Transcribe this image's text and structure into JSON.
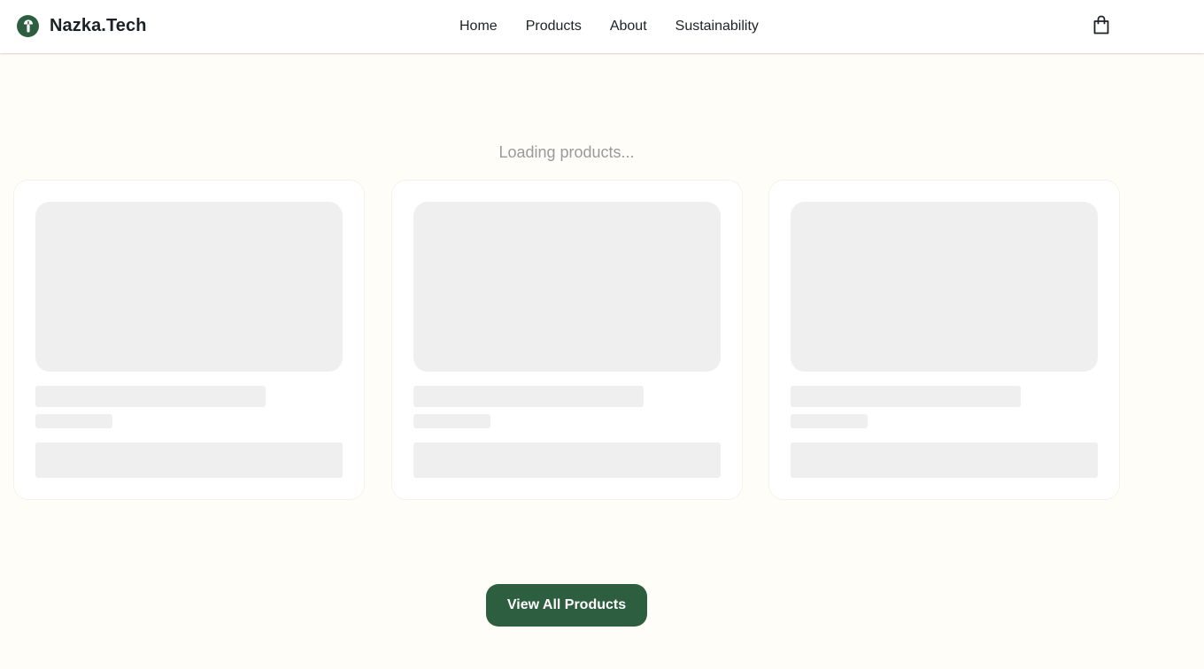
{
  "header": {
    "brand_name": "Nazka.Tech",
    "logo_icon": "brand-logo-icon",
    "nav": [
      {
        "label": "Home"
      },
      {
        "label": "Products"
      },
      {
        "label": "About"
      },
      {
        "label": "Sustainability"
      }
    ],
    "cart_icon": "shopping-bag-icon"
  },
  "main": {
    "loading_text": "Loading products...",
    "skeleton_cards": 3,
    "view_all_label": "View All Products"
  },
  "colors": {
    "brand_green": "#2c5e3f",
    "page_background": "#fffdf7",
    "skeleton": "#efeff0",
    "loading_text": "#9a9a9a"
  }
}
